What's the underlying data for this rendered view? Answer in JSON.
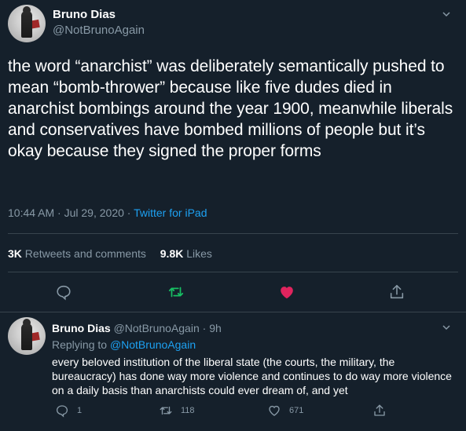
{
  "main_tweet": {
    "author_name": "Bruno Dias",
    "author_handle": "@NotBrunoAgain",
    "text": "the word “anarchist” was deliberately semantically pushed to mean “bomb-thrower” because like five dudes died in anarchist bombings around the year 1900, meanwhile liberals and conservatives have bombed millions of people but it’s okay because they signed the proper forms",
    "time": "10:44 AM",
    "date": "Jul 29, 2020",
    "separator": "·",
    "source": "Twitter for iPad",
    "retweets_count": "3K",
    "retweets_label": "Retweets and comments",
    "likes_count": "9.8K",
    "likes_label": "Likes",
    "liked": true
  },
  "reply_tweet": {
    "author_name": "Bruno Dias",
    "author_handle": "@NotBrunoAgain",
    "separator": "·",
    "age": "9h",
    "replying_label": "Replying to",
    "replying_to": "@NotBrunoAgain",
    "text": "every beloved institution of the liberal state (the courts, the military, the bureaucracy) has done way more violence and continues to do way more violence on a daily basis than anarchists could ever dream of, and yet",
    "reply_count": "1",
    "retweet_count": "118",
    "like_count": "671"
  },
  "icons": {
    "reply": "speech-bubble-icon",
    "retweet": "retweet-arrows-icon",
    "like": "heart-icon",
    "share": "share-upload-icon",
    "menu": "chevron-down-icon"
  },
  "colors": {
    "background": "#15202b",
    "text": "#ffffff",
    "muted": "#8899a6",
    "accent": "#1da1f2",
    "retweet_green": "#17bf63",
    "like_red": "#e0245e",
    "divider": "#38444d"
  }
}
